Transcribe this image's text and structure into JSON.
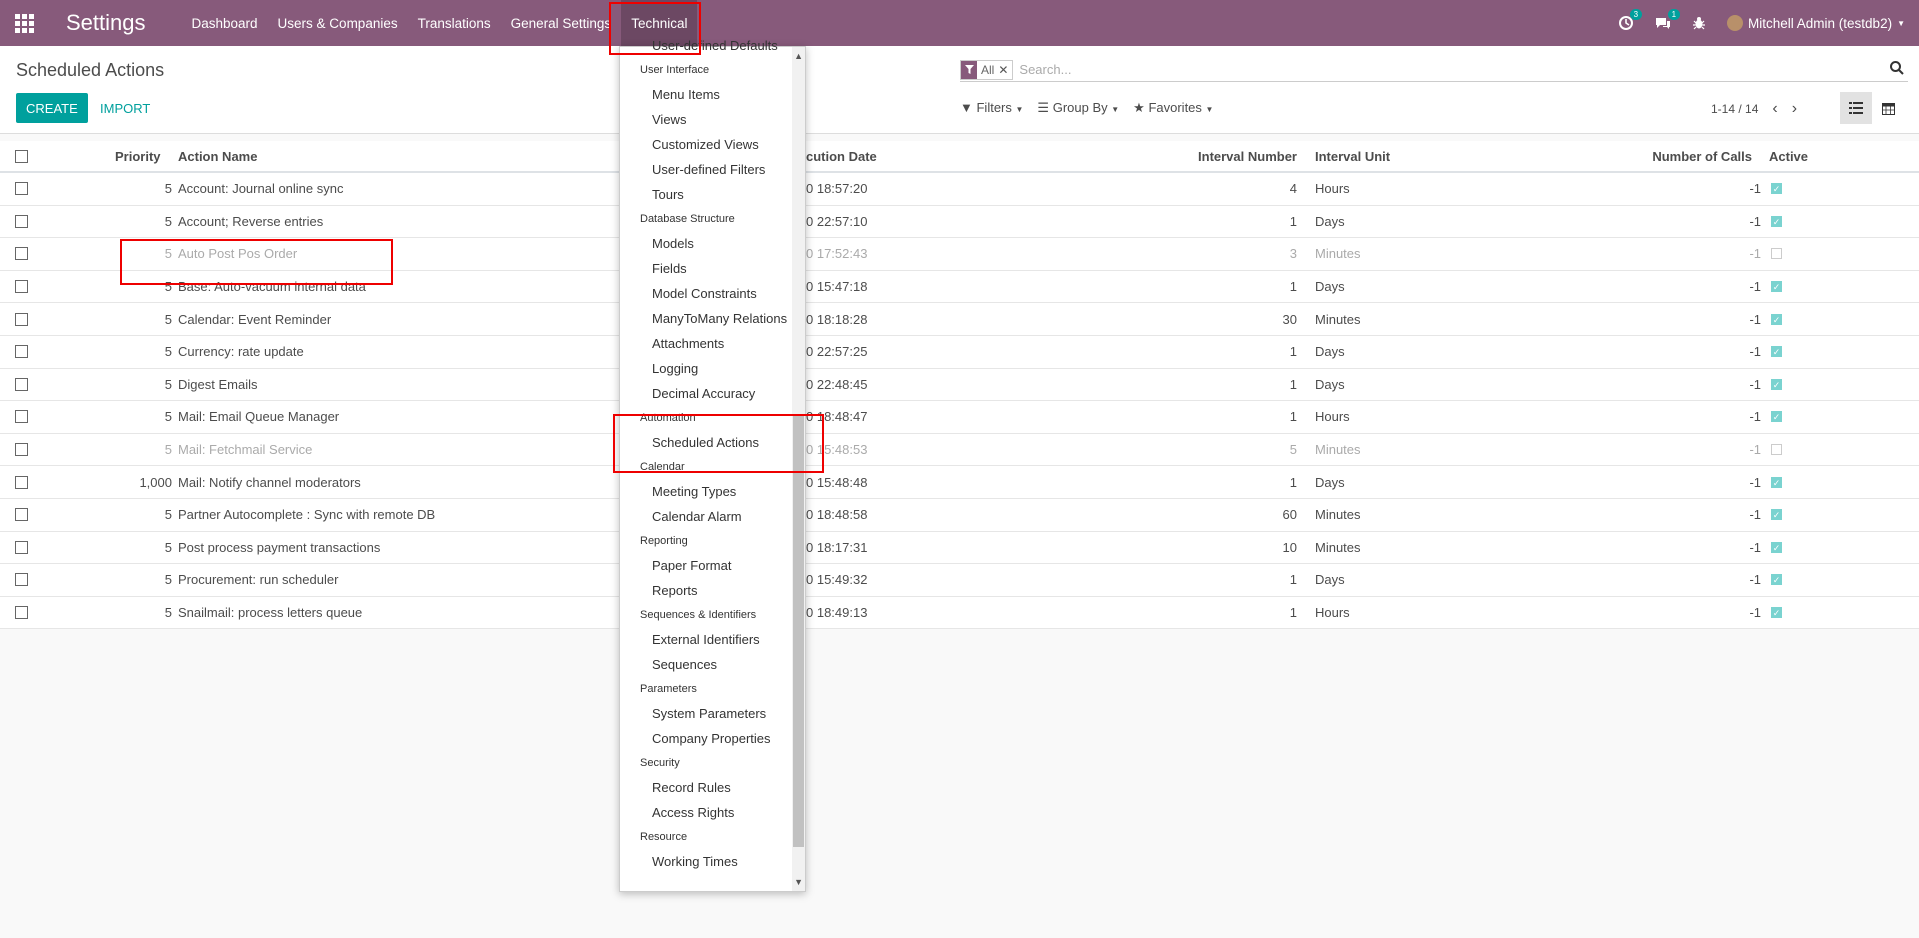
{
  "navbar": {
    "brand": "Settings",
    "menus": [
      "Dashboard",
      "Users & Companies",
      "Translations",
      "General Settings",
      "Technical"
    ],
    "activity_count": "3",
    "message_count": "1",
    "user": "Mitchell Admin (testdb2)"
  },
  "control_panel": {
    "breadcrumb": "Scheduled Actions",
    "create_label": "CREATE",
    "import_label": "IMPORT",
    "facet_value": "All",
    "search_placeholder": "Search...",
    "filters_label": "Filters",
    "groupby_label": "Group By",
    "favorites_label": "Favorites",
    "pager": "1-14 / 14"
  },
  "table": {
    "headers": {
      "priority": "Priority",
      "name": "Action Name",
      "date": "cution Date",
      "interval_number": "Interval Number",
      "interval_unit": "Interval Unit",
      "calls": "Number of Calls",
      "active": "Active"
    },
    "rows": [
      {
        "priority": "5",
        "name": "Account: Journal online sync",
        "date": "0 18:57:20",
        "num": "4",
        "unit": "Hours",
        "calls": "-1",
        "active": true
      },
      {
        "priority": "5",
        "name": "Account; Reverse entries",
        "date": "0 22:57:10",
        "num": "1",
        "unit": "Days",
        "calls": "-1",
        "active": true
      },
      {
        "priority": "5",
        "name": "Auto Post Pos Order",
        "date": "0 17:52:43",
        "num": "3",
        "unit": "Minutes",
        "calls": "-1",
        "active": false
      },
      {
        "priority": "5",
        "name": "Base: Auto-vacuum internal data",
        "date": "0 15:47:18",
        "num": "1",
        "unit": "Days",
        "calls": "-1",
        "active": true
      },
      {
        "priority": "5",
        "name": "Calendar: Event Reminder",
        "date": "0 18:18:28",
        "num": "30",
        "unit": "Minutes",
        "calls": "-1",
        "active": true
      },
      {
        "priority": "5",
        "name": "Currency: rate update",
        "date": "0 22:57:25",
        "num": "1",
        "unit": "Days",
        "calls": "-1",
        "active": true
      },
      {
        "priority": "5",
        "name": "Digest Emails",
        "date": "0 22:48:45",
        "num": "1",
        "unit": "Days",
        "calls": "-1",
        "active": true
      },
      {
        "priority": "5",
        "name": "Mail: Email Queue Manager",
        "date": "0 18:48:47",
        "num": "1",
        "unit": "Hours",
        "calls": "-1",
        "active": true
      },
      {
        "priority": "5",
        "name": "Mail: Fetchmail Service",
        "date": "0 15:48:53",
        "num": "5",
        "unit": "Minutes",
        "calls": "-1",
        "active": false
      },
      {
        "priority": "1,000",
        "name": "Mail: Notify channel moderators",
        "date": "0 15:48:48",
        "num": "1",
        "unit": "Days",
        "calls": "-1",
        "active": true
      },
      {
        "priority": "5",
        "name": "Partner Autocomplete : Sync with remote DB",
        "date": "0 18:48:58",
        "num": "60",
        "unit": "Minutes",
        "calls": "-1",
        "active": true
      },
      {
        "priority": "5",
        "name": "Post process payment transactions",
        "date": "0 18:17:31",
        "num": "10",
        "unit": "Minutes",
        "calls": "-1",
        "active": true
      },
      {
        "priority": "5",
        "name": "Procurement: run scheduler",
        "date": "0 15:49:32",
        "num": "1",
        "unit": "Days",
        "calls": "-1",
        "active": true
      },
      {
        "priority": "5",
        "name": "Snailmail: process letters queue",
        "date": "0 18:49:13",
        "num": "1",
        "unit": "Hours",
        "calls": "-1",
        "active": true
      }
    ]
  },
  "dropdown": {
    "entries": [
      {
        "type": "item",
        "label": "User-defined Defaults"
      },
      {
        "type": "header",
        "label": "User Interface"
      },
      {
        "type": "item",
        "label": "Menu Items"
      },
      {
        "type": "item",
        "label": "Views"
      },
      {
        "type": "item",
        "label": "Customized Views"
      },
      {
        "type": "item",
        "label": "User-defined Filters"
      },
      {
        "type": "item",
        "label": "Tours"
      },
      {
        "type": "header",
        "label": "Database Structure"
      },
      {
        "type": "item",
        "label": "Models"
      },
      {
        "type": "item",
        "label": "Fields"
      },
      {
        "type": "item",
        "label": "Model Constraints"
      },
      {
        "type": "item",
        "label": "ManyToMany Relations"
      },
      {
        "type": "item",
        "label": "Attachments"
      },
      {
        "type": "item",
        "label": "Logging"
      },
      {
        "type": "item",
        "label": "Decimal Accuracy"
      },
      {
        "type": "header",
        "label": "Automation"
      },
      {
        "type": "item",
        "label": "Scheduled Actions"
      },
      {
        "type": "header",
        "label": "Calendar"
      },
      {
        "type": "item",
        "label": "Meeting Types"
      },
      {
        "type": "item",
        "label": "Calendar Alarm"
      },
      {
        "type": "header",
        "label": "Reporting"
      },
      {
        "type": "item",
        "label": "Paper Format"
      },
      {
        "type": "item",
        "label": "Reports"
      },
      {
        "type": "header",
        "label": "Sequences & Identifiers"
      },
      {
        "type": "item",
        "label": "External Identifiers"
      },
      {
        "type": "item",
        "label": "Sequences"
      },
      {
        "type": "header",
        "label": "Parameters"
      },
      {
        "type": "item",
        "label": "System Parameters"
      },
      {
        "type": "item",
        "label": "Company Properties"
      },
      {
        "type": "header",
        "label": "Security"
      },
      {
        "type": "item",
        "label": "Record Rules"
      },
      {
        "type": "item",
        "label": "Access Rights"
      },
      {
        "type": "header",
        "label": "Resource"
      },
      {
        "type": "item",
        "label": "Working Times"
      }
    ]
  },
  "colors": {
    "brand": "#875a7b",
    "accent": "#00a09d",
    "highlight": "#e00000"
  }
}
